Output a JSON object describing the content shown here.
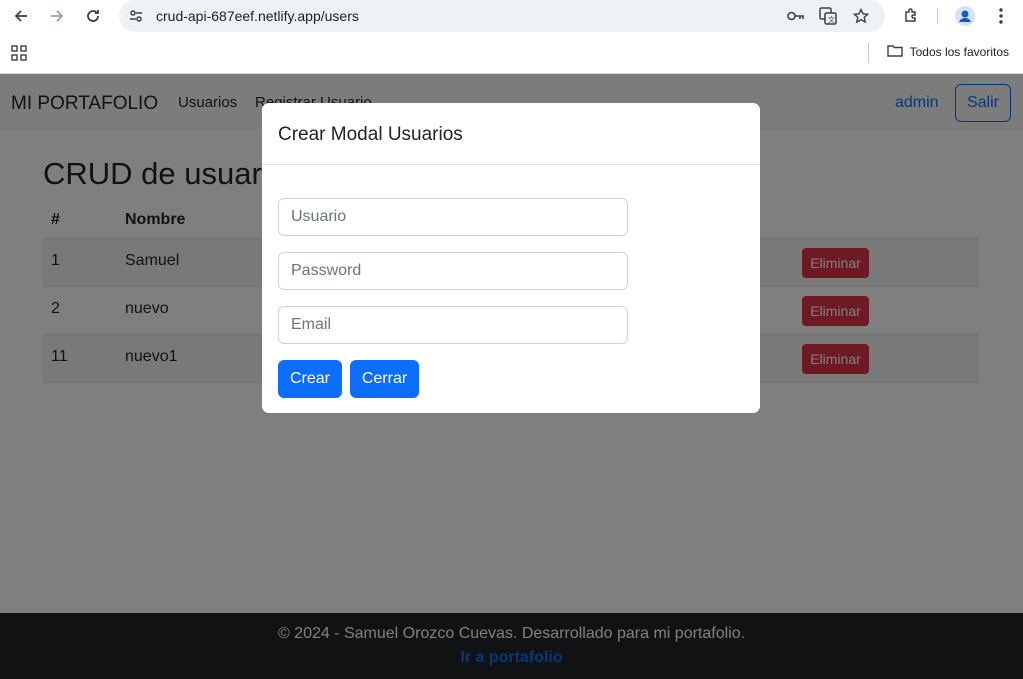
{
  "browser": {
    "url": "crud-api-687eef.netlify.app/users",
    "bookmarks_folder": "Todos los favoritos",
    "icons": [
      "back-arrow-icon",
      "forward-arrow-icon",
      "reload-icon",
      "site-info-icon",
      "key-icon",
      "translate-icon",
      "star-icon",
      "extensions-icon",
      "profile-icon",
      "menu-dots-icon",
      "apps-grid-icon",
      "folder-icon"
    ]
  },
  "navbar": {
    "brand": "MI PORTAFOLIO",
    "links": [
      "Usuarios",
      "Registrar Usuario"
    ],
    "user": "admin",
    "logout": "Salir"
  },
  "main": {
    "title": "CRUD de usuarios con autenticación JWT",
    "columns": [
      "#",
      "Nombre"
    ],
    "rows": [
      {
        "id": "1",
        "name": "Samuel",
        "action": "Eliminar"
      },
      {
        "id": "2",
        "name": "nuevo",
        "action": "Eliminar"
      },
      {
        "id": "11",
        "name": "nuevo1",
        "action": "Eliminar"
      }
    ]
  },
  "modal": {
    "title": "Crear Modal Usuarios",
    "usuario_placeholder": "Usuario",
    "password_placeholder": "Password",
    "email_placeholder": "Email",
    "create": "Crear",
    "close": "Cerrar"
  },
  "footer": {
    "text": "© 2024 - Samuel Orozco Cuevas. Desarrollado para mi portafolio.",
    "link": "Ir a portafolio"
  },
  "colors": {
    "primary": "#0d6efd",
    "danger": "#dc3545",
    "footer_bg": "#212529"
  }
}
